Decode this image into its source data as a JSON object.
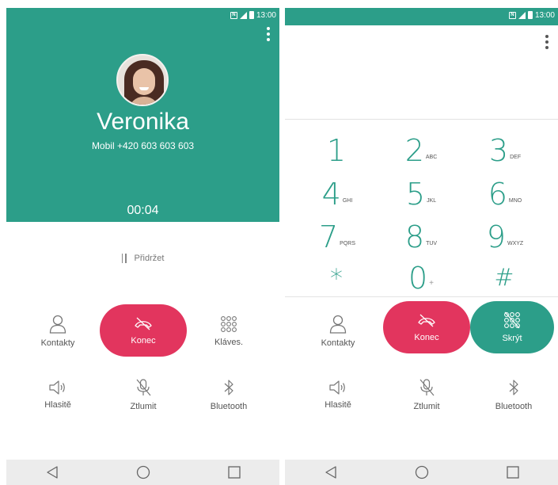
{
  "status_time": "13:00",
  "call_screen": {
    "caller_name": "Veronika",
    "caller_number": "Mobil   +420 603 603 603",
    "timer": "00:04",
    "hold_label": "Přidržet",
    "actions": {
      "contacts": "Kontakty",
      "end": "Konec",
      "keypad": "Kláves.",
      "speaker": "Hlasitě",
      "mute": "Ztlumit",
      "bluetooth": "Bluetooth"
    }
  },
  "keypad_screen": {
    "keys": [
      {
        "digit": "1",
        "letters": ""
      },
      {
        "digit": "2",
        "letters": "ABC"
      },
      {
        "digit": "3",
        "letters": "DEF"
      },
      {
        "digit": "4",
        "letters": "GHI"
      },
      {
        "digit": "5",
        "letters": "JKL"
      },
      {
        "digit": "6",
        "letters": "MNO"
      },
      {
        "digit": "7",
        "letters": "PQRS"
      },
      {
        "digit": "8",
        "letters": "TUV"
      },
      {
        "digit": "9",
        "letters": "WXYZ"
      },
      {
        "digit": "*",
        "letters": ""
      },
      {
        "digit": "0",
        "letters": "+"
      },
      {
        "digit": "#",
        "letters": ""
      }
    ],
    "actions": {
      "contacts": "Kontakty",
      "end": "Konec",
      "hide": "Skrýt",
      "speaker": "Hlasitě",
      "mute": "Ztlumit",
      "bluetooth": "Bluetooth"
    }
  },
  "colors": {
    "accent_green": "#2c9e89",
    "end_red": "#e2355e"
  }
}
